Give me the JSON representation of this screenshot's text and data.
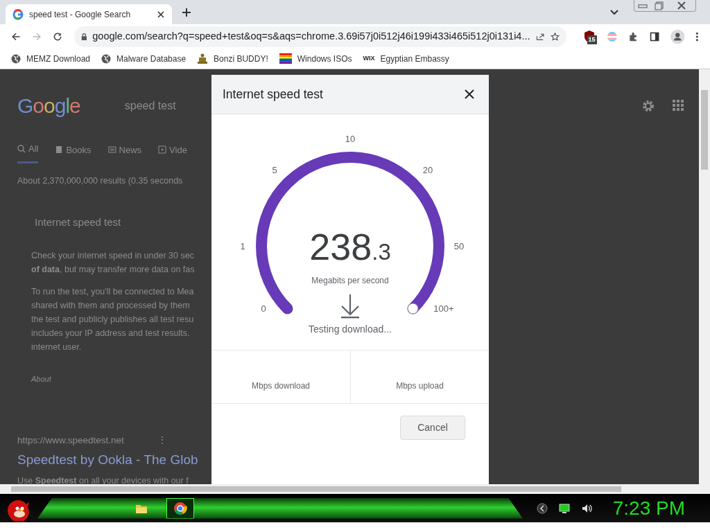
{
  "browser": {
    "tab": {
      "title": "speed test - Google Search",
      "selected": true
    },
    "url": "google.com/search?q=speed+test&oq=s&aqs=chrome.3.69i57j0i512j46i199i433i465i512j0i131i4...",
    "forward_disabled": true,
    "extension_badge": "15"
  },
  "bookmarks": [
    {
      "label": "MEMZ Download"
    },
    {
      "label": "Malware Database"
    },
    {
      "label": "Bonzi BUDDY!"
    },
    {
      "label": "Windows ISOs"
    },
    {
      "label": "Egyptian Embassy",
      "icon_text": "WIX"
    }
  ],
  "page": {
    "logo": "Google",
    "query": "speed test",
    "tabs": [
      {
        "label": "All",
        "selected": true
      },
      {
        "label": "Books",
        "selected": false
      },
      {
        "label": "News",
        "selected": false
      },
      {
        "label": "Vide",
        "selected": false
      }
    ],
    "result_stats": "About 2,370,000,000 results (0.35 seconds",
    "card_title": "Internet speed test",
    "paragraphs": [
      [
        "Check your internet speed in under 30 sec",
        "**of data**, but may transfer more data on fas"
      ],
      [
        "To run the test, you'll be connected to Mea",
        "shared with them and processed by them",
        "the test and publicly publishes all test resu",
        "includes your IP address and test results.",
        "internet user."
      ]
    ],
    "about": "About",
    "result": {
      "url": "https://www.speedtest.net",
      "more": "⋮",
      "title": "Speedtest by Ookla - The Glob",
      "snippet": "Use **Speedtest** on all your devices with our f"
    }
  },
  "dialog": {
    "title": "Internet speed test",
    "gauge": {
      "ticks": [
        "0",
        "1",
        "5",
        "10",
        "20",
        "50",
        "100+"
      ],
      "level": 1,
      "value_int": "238",
      "value_dec": ".3",
      "unit": "Megabits per second",
      "status": "Testing download..."
    },
    "results": [
      "Mbps download",
      "Mbps upload"
    ],
    "cancel": "Cancel"
  },
  "taskbar": {
    "apps": [
      {
        "active": false
      },
      {
        "active": true
      }
    ],
    "clock": "7:23 PM"
  }
}
